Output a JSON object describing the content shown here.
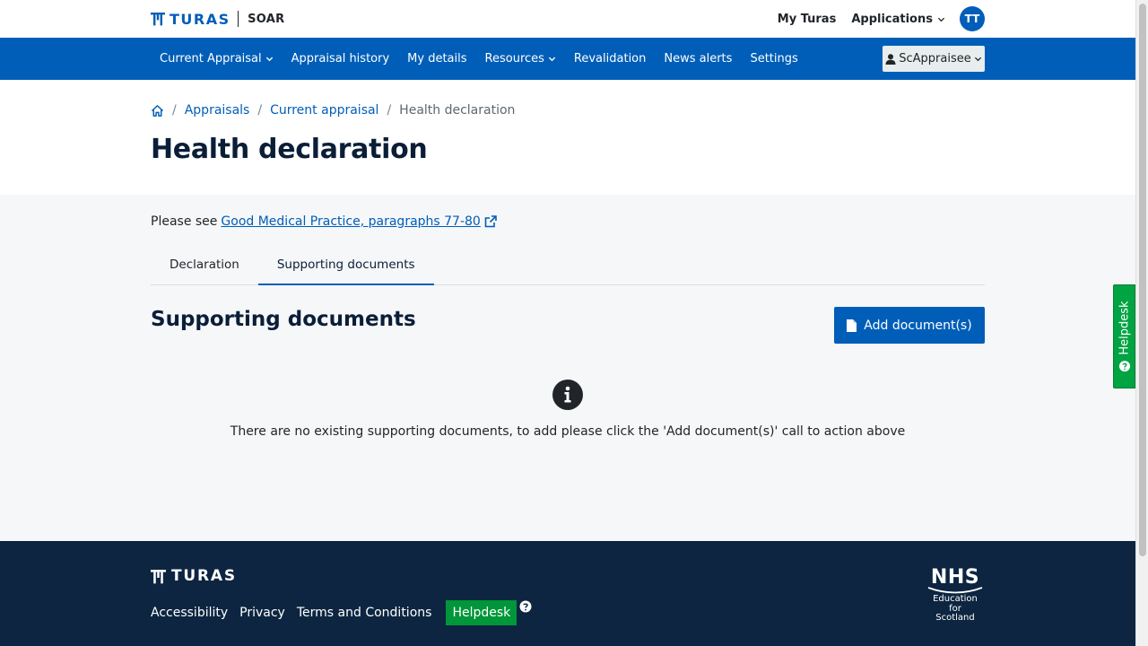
{
  "header": {
    "brand": "TURAS",
    "product": "SOAR",
    "links": [
      {
        "label": "My Turas"
      },
      {
        "label": "Applications"
      }
    ],
    "avatar_initials": "TT"
  },
  "nav": {
    "items": [
      {
        "label": "Current Appraisal",
        "dropdown": true
      },
      {
        "label": "Appraisal history"
      },
      {
        "label": "My details"
      },
      {
        "label": "Resources",
        "dropdown": true
      },
      {
        "label": "Revalidation"
      },
      {
        "label": "News alerts"
      },
      {
        "label": "Settings"
      }
    ],
    "user_menu": "ScAppraisee"
  },
  "breadcrumb": {
    "items": [
      "Appraisals",
      "Current appraisal"
    ],
    "current": "Health declaration"
  },
  "page_title": "Health declaration",
  "see_line": {
    "prefix": "Please see",
    "link": "Good Medical Practice, paragraphs 77-80"
  },
  "tabs": [
    {
      "label": "Declaration",
      "active": false
    },
    {
      "label": "Supporting documents",
      "active": true
    }
  ],
  "section": {
    "title": "Supporting documents",
    "add_button": "Add document(s)",
    "empty_message": "There are no existing supporting documents, to add please click the 'Add document(s)' call to action above"
  },
  "side_helpdesk": "Helpdesk",
  "footer": {
    "brand": "TURAS",
    "links": [
      "Accessibility",
      "Privacy",
      "Terms and Conditions"
    ],
    "helpdesk": "Helpdesk",
    "nhs": {
      "word": "NHS",
      "lines": [
        "Education",
        "for",
        "Scotland"
      ]
    }
  },
  "colors": {
    "primary": "#005eb8",
    "footer_bg": "#0d2540",
    "helpdesk_green": "#009639",
    "content_bg": "#f6f7f9"
  }
}
